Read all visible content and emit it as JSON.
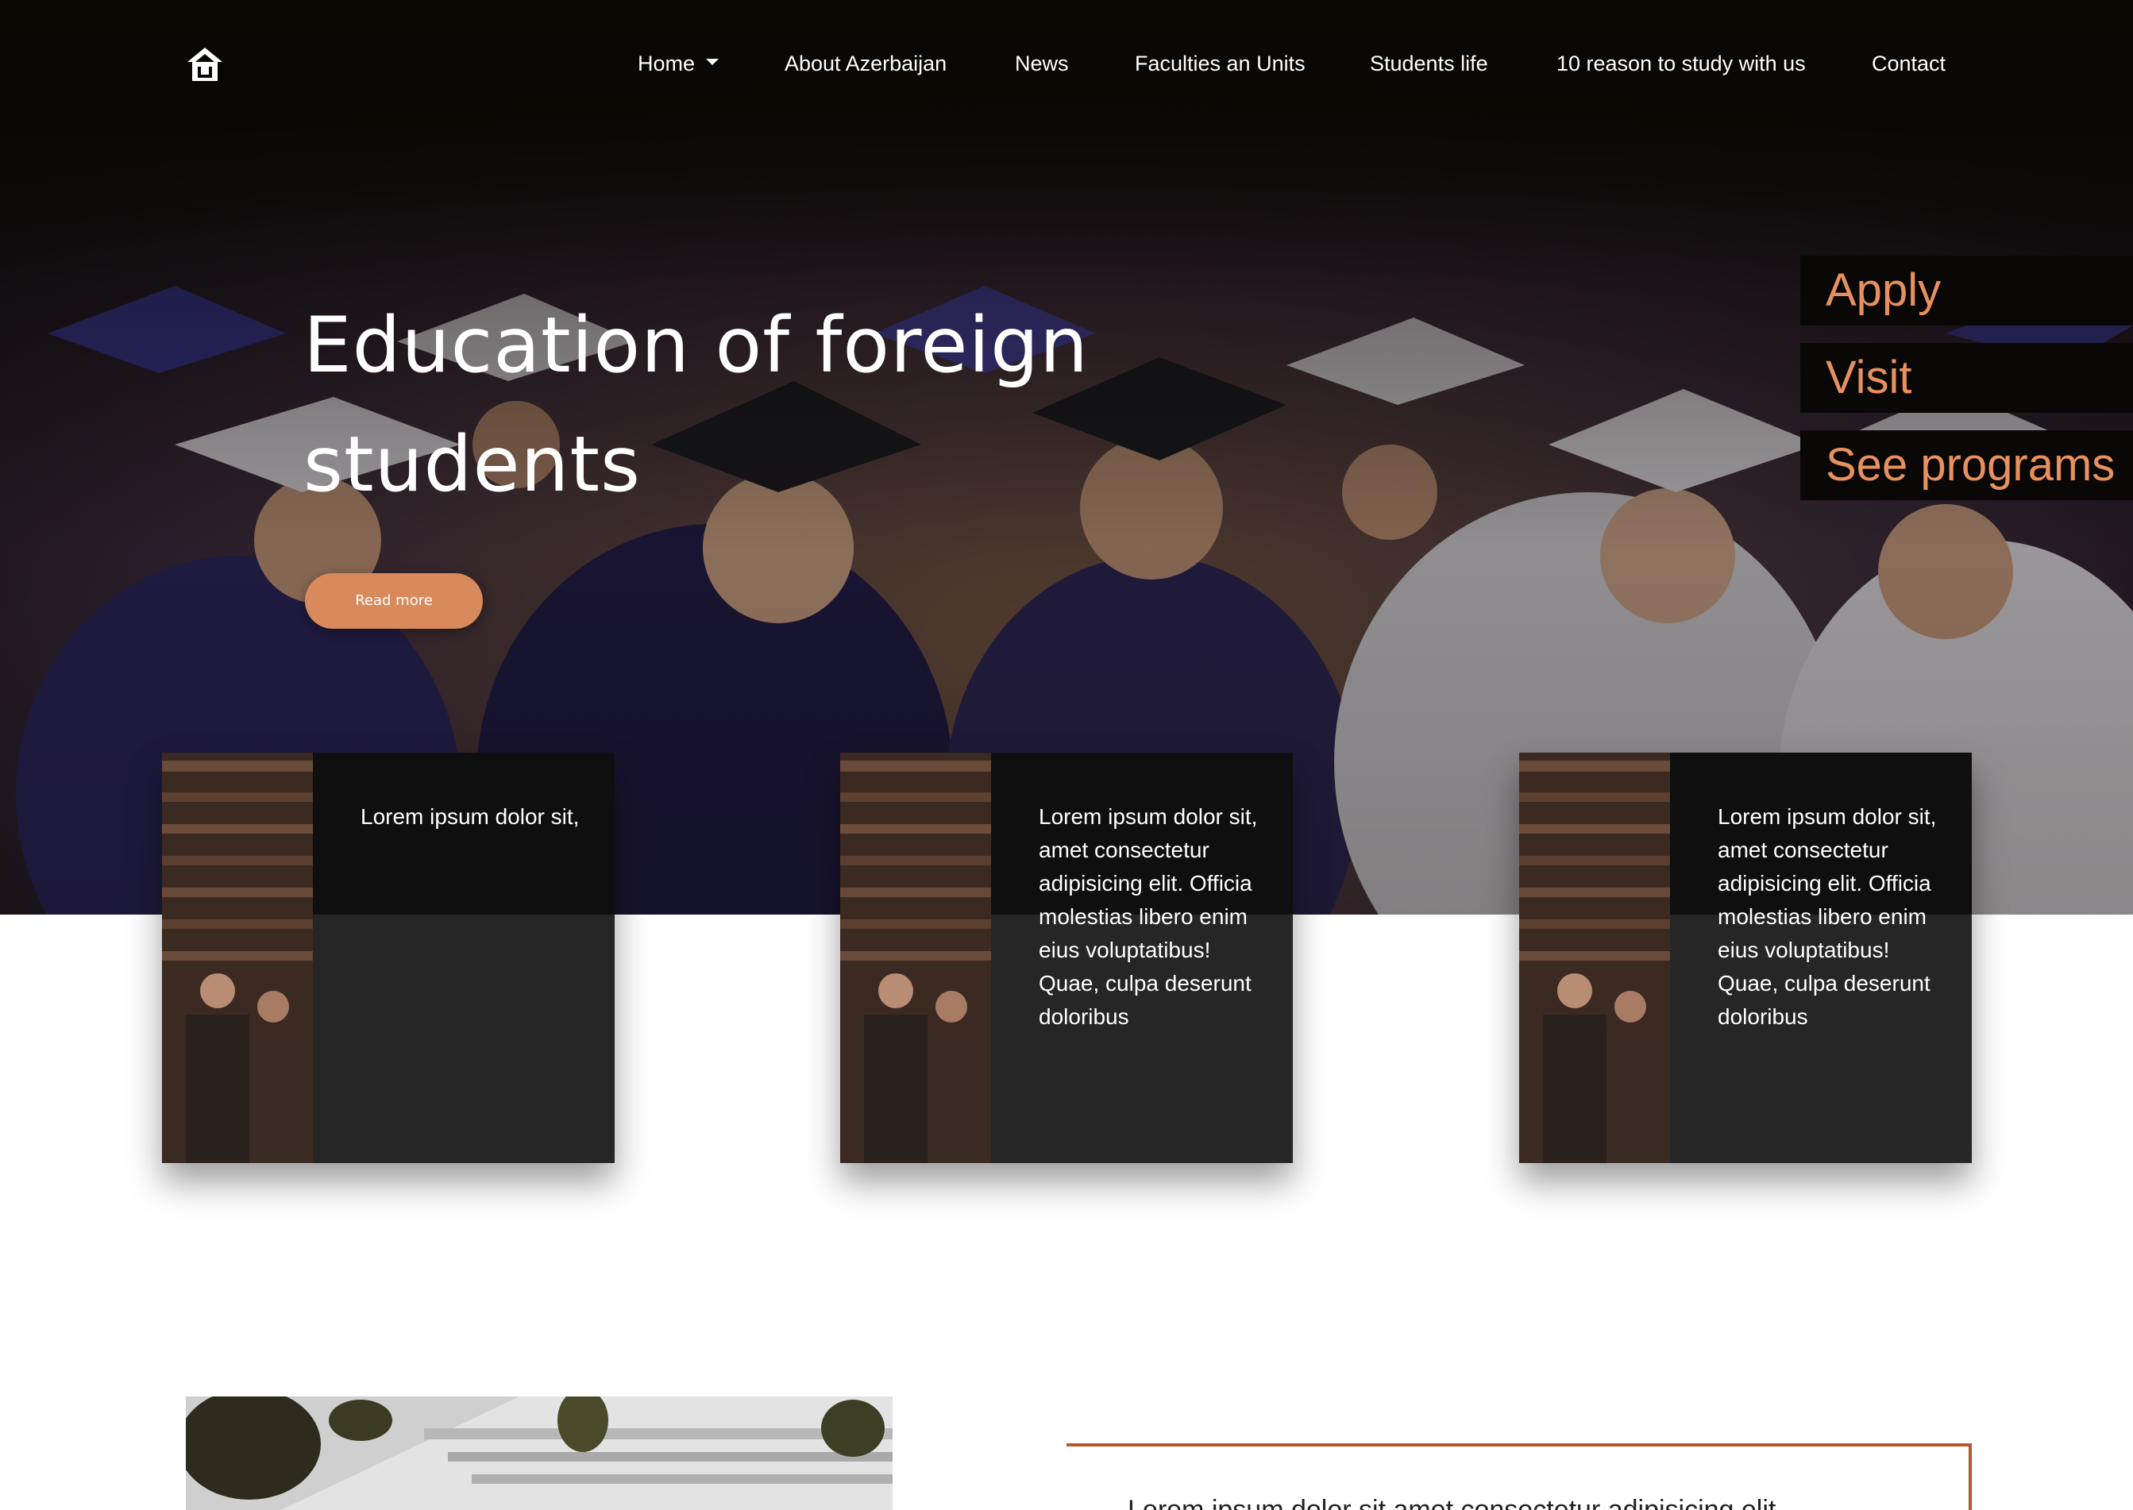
{
  "colors": {
    "accent": "#d98a5c",
    "side_link_text": "#e8915e",
    "frame_border": "#b5582d",
    "card_bg": "#262626"
  },
  "nav": {
    "logo_icon": "house-logo-icon",
    "items": [
      {
        "label": "Home",
        "has_dropdown": true
      },
      {
        "label": "About Azerbaijan"
      },
      {
        "label": "News"
      },
      {
        "label": "Faculties an Units"
      },
      {
        "label": "Students life"
      },
      {
        "label": "10 reason to study with us"
      },
      {
        "label": "Contact"
      }
    ]
  },
  "hero": {
    "title_line1": "Education of foreign",
    "title_line2": "students",
    "button_label": "Read more"
  },
  "side_links": [
    {
      "label": "Apply"
    },
    {
      "label": "Visit"
    },
    {
      "label": "See programs"
    }
  ],
  "cards": [
    {
      "text": "Lorem ipsum dolor sit,"
    },
    {
      "text": "Lorem ipsum dolor sit, amet consectetur adipisicing elit. Officia molestias libero enim eius voluptatibus! Quae, culpa deserunt doloribus"
    },
    {
      "text": "Lorem ipsum dolor sit, amet consectetur adipisicing elit. Officia molestias libero enim eius voluptatibus! Quae, culpa deserunt doloribus"
    }
  ],
  "lower": {
    "frame_text": "Lorem ipsum dolor sit amet consectetur adipisicing elit"
  }
}
